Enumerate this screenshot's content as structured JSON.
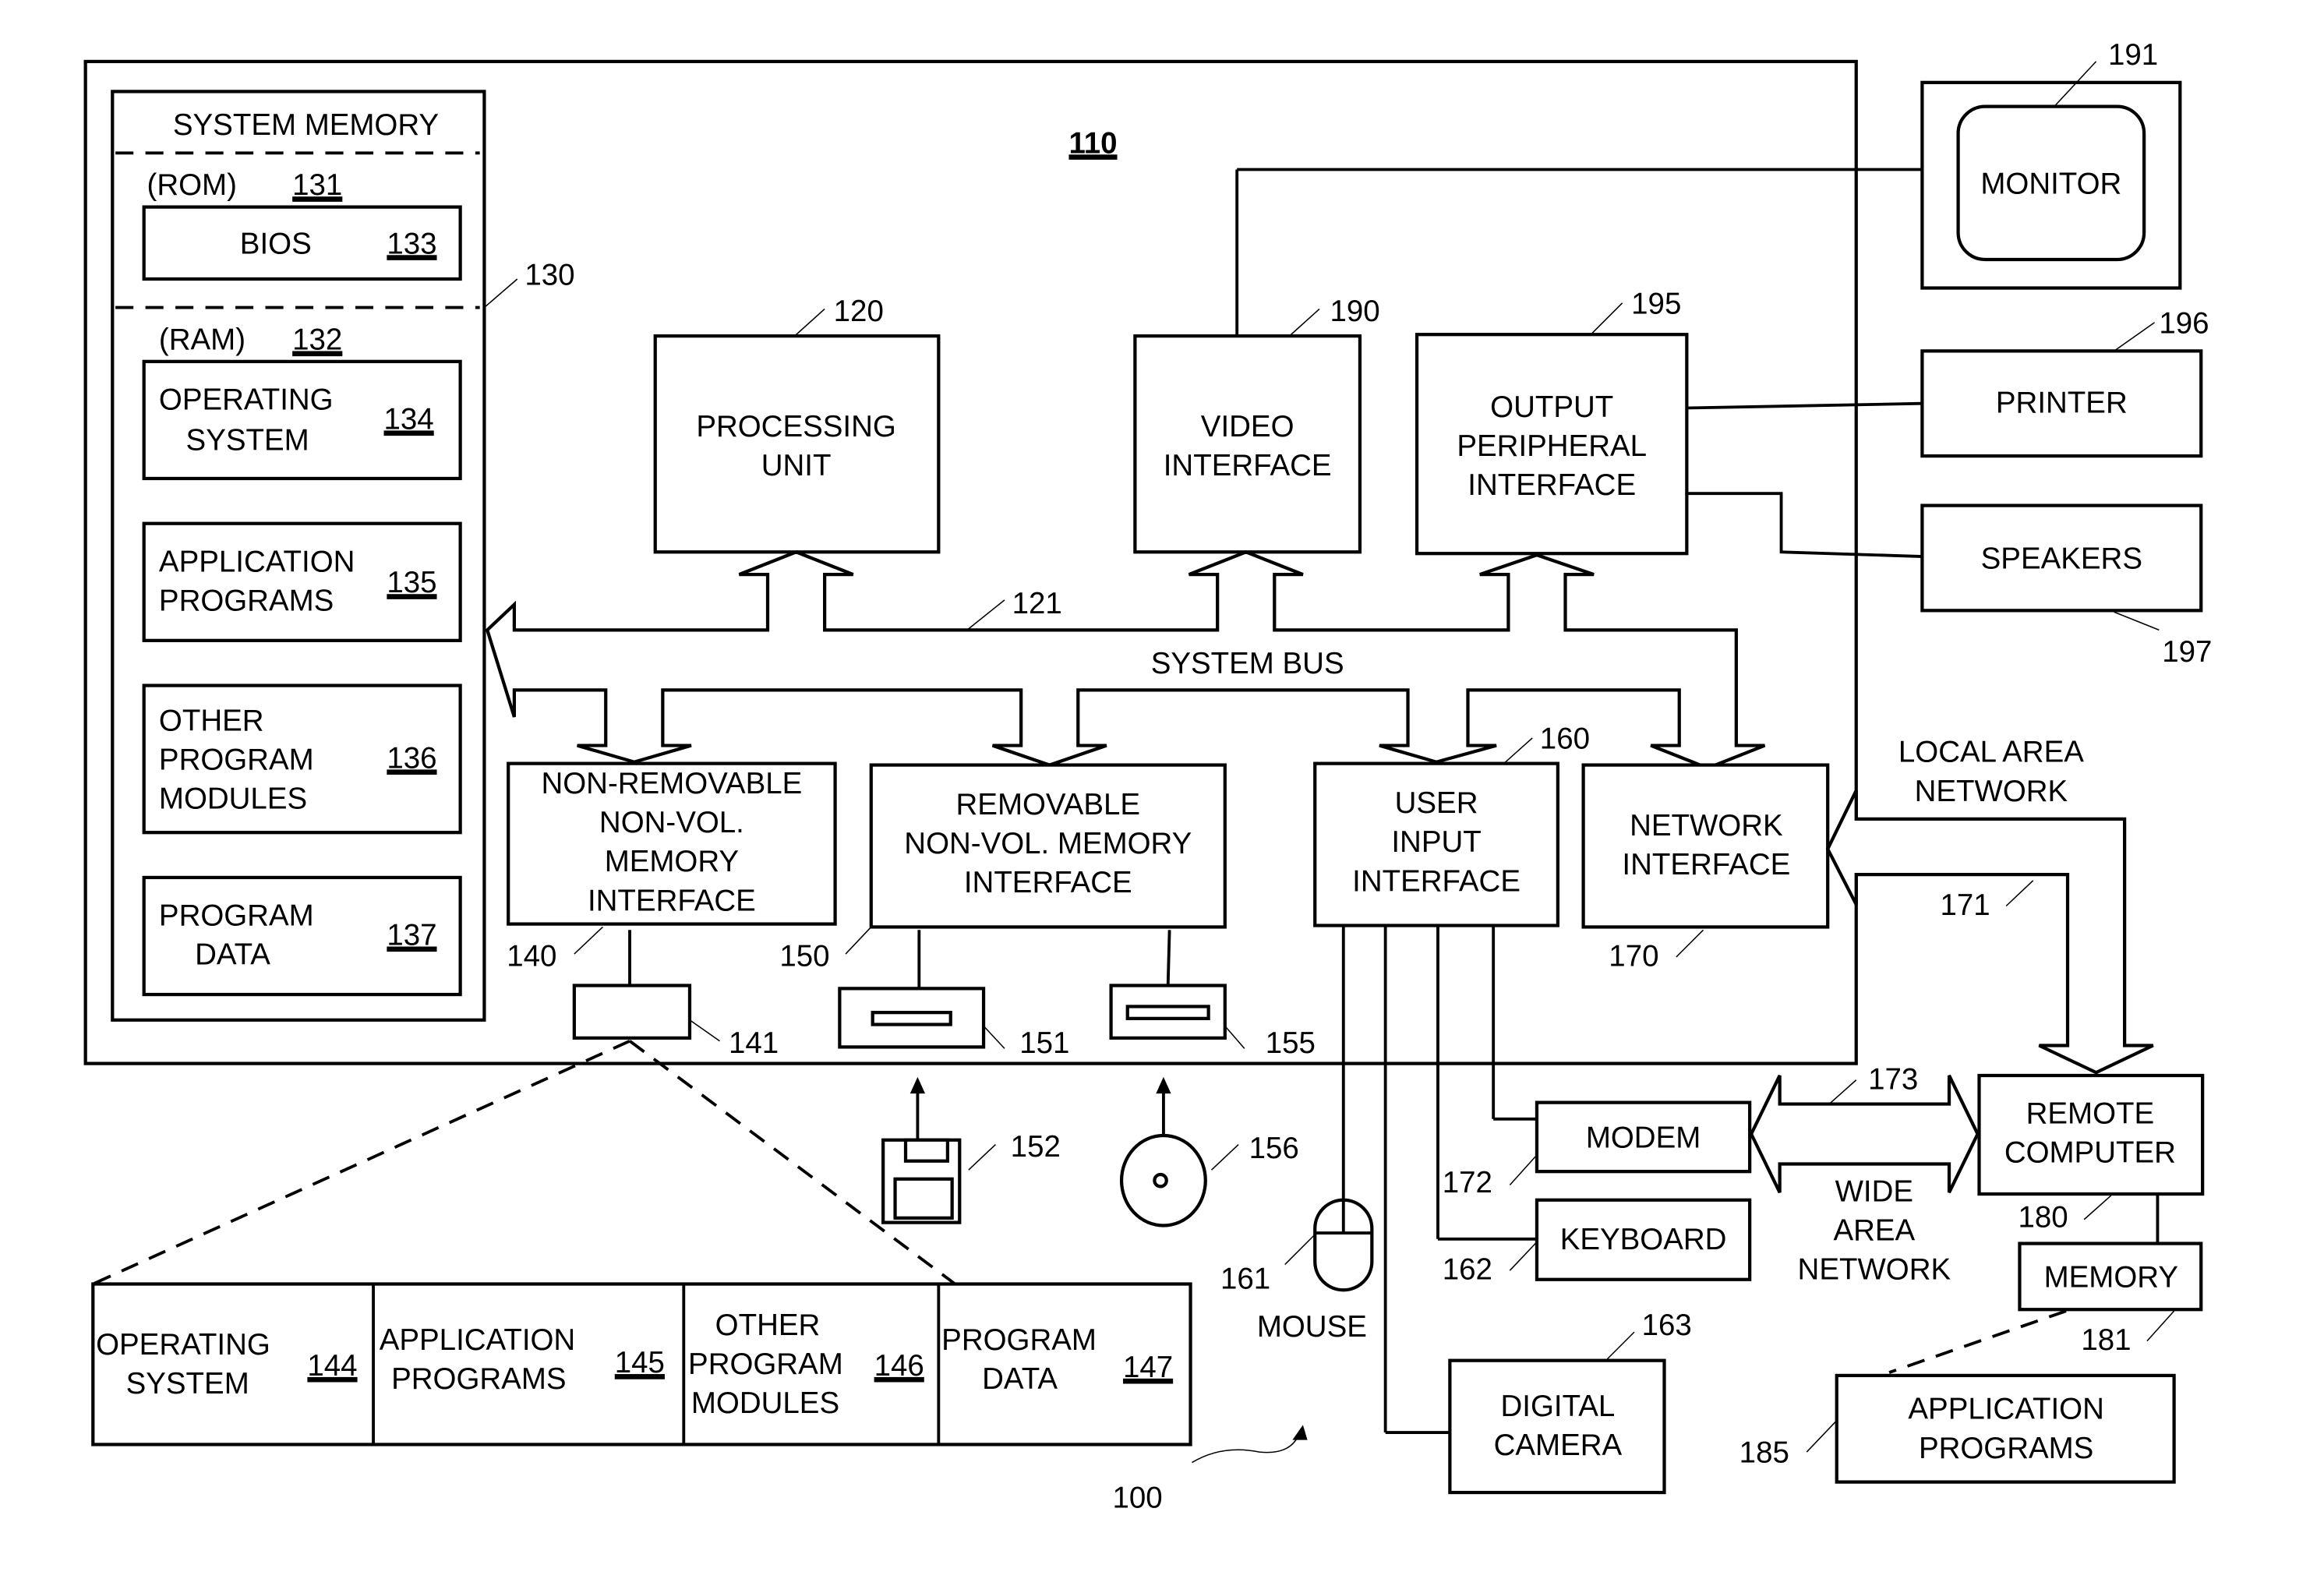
{
  "figure": {
    "computer_label": "110",
    "system_ref": "100",
    "system_memory": {
      "title": "SYSTEM MEMORY",
      "ref": "130",
      "rom_label": "(ROM)",
      "rom_ref": "131",
      "ram_label": "(RAM)",
      "ram_ref": "132",
      "bios": {
        "label": "BIOS",
        "ref": "133"
      },
      "items": [
        {
          "line1": "OPERATING",
          "line2": "SYSTEM",
          "line3": "",
          "ref": "134"
        },
        {
          "line1": "APPLICATION",
          "line2": "PROGRAMS",
          "line3": "",
          "ref": "135"
        },
        {
          "line1": "OTHER",
          "line2": "PROGRAM",
          "line3": "MODULES",
          "ref": "136"
        },
        {
          "line1": "PROGRAM",
          "line2": "DATA",
          "line3": "",
          "ref": "137"
        }
      ]
    },
    "processing_unit": {
      "line1": "PROCESSING",
      "line2": "UNIT",
      "ref": "120"
    },
    "video_interface": {
      "line1": "VIDEO",
      "line2": "INTERFACE",
      "ref": "190"
    },
    "output_peripheral": {
      "line1": "OUTPUT",
      "line2": "PERIPHERAL",
      "line3": "INTERFACE",
      "ref": "195"
    },
    "system_bus": {
      "label": "SYSTEM BUS",
      "ref": "121"
    },
    "nonremovable": {
      "line1": "NON-REMOVABLE",
      "line2": "NON-VOL.",
      "line3": "MEMORY",
      "line4": "INTERFACE",
      "ref": "140"
    },
    "removable": {
      "line1": "REMOVABLE",
      "line2": "NON-VOL. MEMORY",
      "line3": "INTERFACE",
      "ref": "150"
    },
    "user_input": {
      "line1": "USER",
      "line2": "INPUT",
      "line3": "INTERFACE",
      "ref": "160"
    },
    "network_interface": {
      "line1": "NETWORK",
      "line2": "INTERFACE",
      "ref": "170"
    },
    "devices": {
      "hard_disk_ref": "141",
      "floppy_drive_ref": "151",
      "optical_drive_ref": "155",
      "floppy_disk_ref": "152",
      "optical_disk_ref": "156"
    },
    "monitor": {
      "label": "MONITOR",
      "ref": "191"
    },
    "printer": {
      "label": "PRINTER",
      "ref": "196"
    },
    "speakers": {
      "label": "SPEAKERS",
      "ref": "197"
    },
    "lan": {
      "line1": "LOCAL AREA",
      "line2": "NETWORK",
      "ref": "171"
    },
    "wan": {
      "line1": "WIDE",
      "line2": "AREA",
      "line3": "NETWORK",
      "ref": "173"
    },
    "modem": {
      "label": "MODEM",
      "ref": "172"
    },
    "keyboard": {
      "label": "KEYBOARD",
      "ref": "162"
    },
    "mouse": {
      "label": "MOUSE",
      "ref": "161"
    },
    "camera": {
      "line1": "DIGITAL",
      "line2": "CAMERA",
      "ref": "163"
    },
    "remote_computer": {
      "line1": "REMOTE",
      "line2": "COMPUTER",
      "ref": "180"
    },
    "remote_memory": {
      "label": "MEMORY",
      "ref": "181"
    },
    "remote_apps": {
      "line1": "APPLICATION",
      "line2": "PROGRAMS",
      "ref": "185"
    },
    "disk_contents": [
      {
        "line1": "OPERATING",
        "line2": "SYSTEM",
        "line3": "",
        "ref": "144"
      },
      {
        "line1": "APPLICATION",
        "line2": "PROGRAMS",
        "line3": "",
        "ref": "145"
      },
      {
        "line1": "OTHER",
        "line2": "PROGRAM",
        "line3": "MODULES",
        "ref": "146"
      },
      {
        "line1": "PROGRAM",
        "line2": "DATA",
        "line3": "",
        "ref": "147"
      }
    ]
  }
}
